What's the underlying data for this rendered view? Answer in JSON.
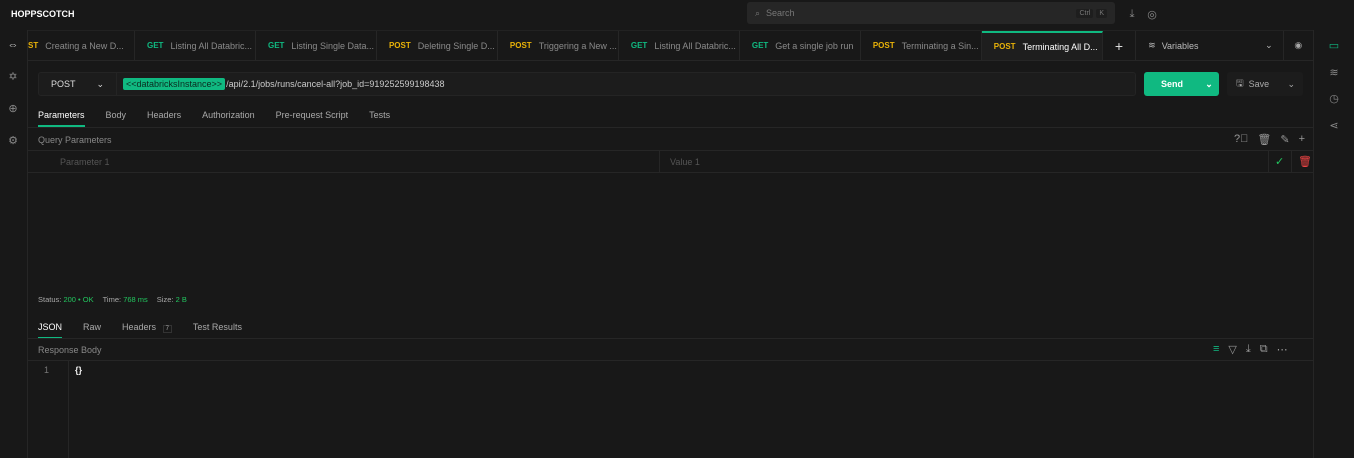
{
  "app": {
    "title": "HOPPSCOTCH"
  },
  "search": {
    "placeholder": "Search",
    "shortcut": [
      "Ctrl",
      "K"
    ]
  },
  "tabs": [
    {
      "method": "ST",
      "label": "Creating a New D...",
      "method_color": "post"
    },
    {
      "method": "GET",
      "label": "Listing All Databric...",
      "method_color": "get"
    },
    {
      "method": "GET",
      "label": "Listing Single Data...",
      "method_color": "get"
    },
    {
      "method": "POST",
      "label": "Deleting Single D...",
      "method_color": "post"
    },
    {
      "method": "POST",
      "label": "Triggering a New ...",
      "method_color": "post"
    },
    {
      "method": "GET",
      "label": "Listing All Databric...",
      "method_color": "get"
    },
    {
      "method": "GET",
      "label": "Get a single job run",
      "method_color": "get"
    },
    {
      "method": "POST",
      "label": "Terminating a Sin...",
      "method_color": "post"
    },
    {
      "method": "POST",
      "label": "Terminating All D...",
      "method_color": "post",
      "active": true
    }
  ],
  "variables_label": "Variables",
  "request": {
    "method": "POST",
    "env_var": "<<databricksInstance>>",
    "path": "/api/2.1/jobs/runs/cancel-all?job_id=919252599198438"
  },
  "send_label": "Send",
  "save_label": "Save",
  "request_tabs": [
    "Parameters",
    "Body",
    "Headers",
    "Authorization",
    "Pre-request Script",
    "Tests"
  ],
  "query": {
    "title": "Query Parameters",
    "param_placeholder": "Parameter 1",
    "value_placeholder": "Value 1"
  },
  "status": {
    "status_label": "Status:",
    "status_value": "200 • OK",
    "time_label": "Time:",
    "time_value": "768 ms",
    "size_label": "Size:",
    "size_value": "2 B"
  },
  "response_tabs": [
    "JSON",
    "Raw",
    "Headers",
    "Test Results"
  ],
  "headers_count": "7",
  "response": {
    "title": "Response Body",
    "line_number": "1",
    "body": "{}"
  },
  "colors": {
    "accent": "#10b981",
    "get": "#10b981",
    "post": "#eab308",
    "danger": "#ef4444"
  }
}
